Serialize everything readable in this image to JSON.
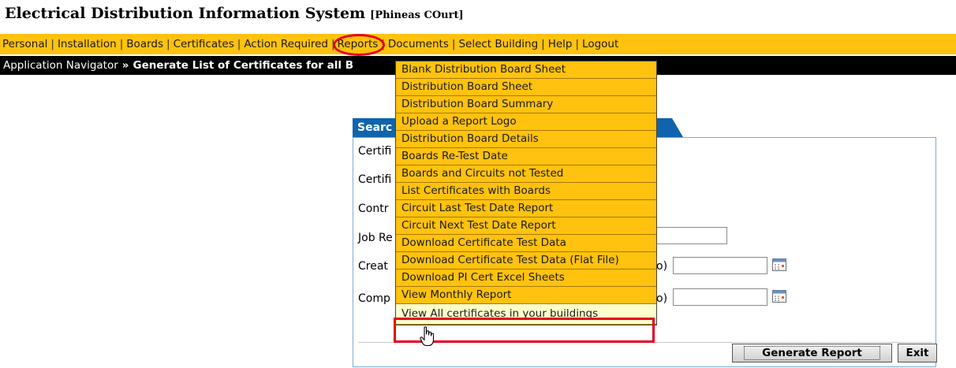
{
  "app": {
    "title": "Electrical Distribution Information System",
    "building": "[Phineas COurt]"
  },
  "nav": {
    "items": [
      {
        "label": "Personal"
      },
      {
        "label": "Installation"
      },
      {
        "label": "Boards"
      },
      {
        "label": "Certificates"
      },
      {
        "label": "Action Required"
      },
      {
        "label": "Reports"
      },
      {
        "label": "Documents"
      },
      {
        "label": "Select Building"
      },
      {
        "label": "Help"
      },
      {
        "label": "Logout"
      }
    ],
    "separator": "|"
  },
  "breadcrumb": {
    "root": "Application Navigator",
    "separator": "»",
    "current": "Generate List of Certificates for all B"
  },
  "reports_menu": {
    "items": [
      {
        "label": "Blank Distribution Board Sheet"
      },
      {
        "label": "Distribution Board Sheet"
      },
      {
        "label": "Distribution Board Summary"
      },
      {
        "label": "Upload a Report Logo"
      },
      {
        "label": "Distribution Board Details"
      },
      {
        "label": "Boards Re-Test Date"
      },
      {
        "label": "Boards and Circuits not Tested"
      },
      {
        "label": "List Certificates with Boards"
      },
      {
        "label": "Circuit Last Test Date Report"
      },
      {
        "label": "Circuit Next Test Date Report"
      },
      {
        "label": "Download Certificate Test Data"
      },
      {
        "label": "Download Certificate Test Data (Flat File)"
      },
      {
        "label": "Download PI Cert Excel Sheets"
      },
      {
        "label": "View Monthly Report"
      },
      {
        "label": "View All certificates in your buildings"
      }
    ],
    "hovered_index": 14
  },
  "search_panel": {
    "tab_label": "Searc",
    "fields": {
      "certificate_1": "Certifi",
      "certificate_2": "Certifi",
      "contractor": "Contr",
      "job_ref": "Job Re",
      "created": "Creat",
      "created_suffix": "o)",
      "completed": "Comp",
      "completed_suffix": "o)"
    },
    "job_ref_value": "",
    "created_to_value": "",
    "completed_to_value": ""
  },
  "buttons": {
    "generate": "Generate Report",
    "exit": "Exit"
  },
  "colors": {
    "nav_bg": "#ffc20e",
    "breadcrumb_bg": "#000000",
    "panel_tab": "#0f64ad",
    "highlight": "#e3001b",
    "menu_hover": "#ffffcc"
  }
}
